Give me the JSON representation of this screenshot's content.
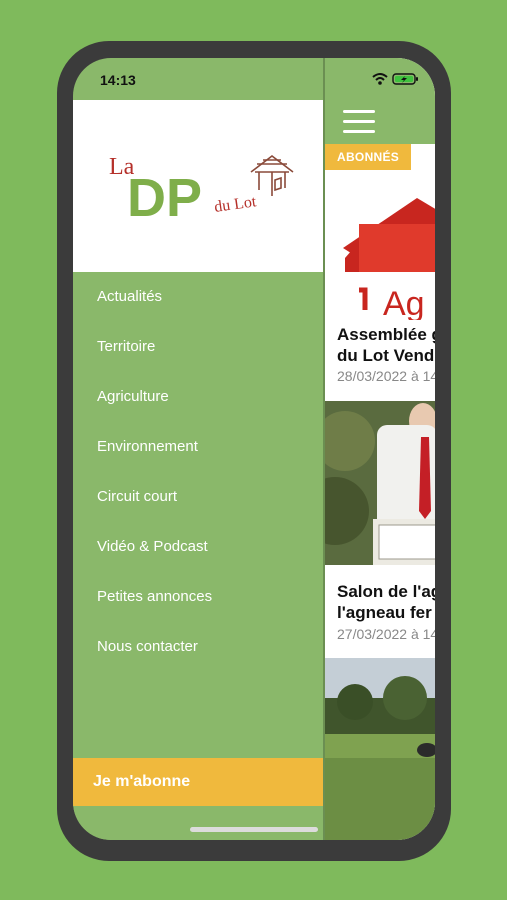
{
  "status_bar": {
    "time": "14:13"
  },
  "logo": {
    "la": "La",
    "dp": "DP",
    "du_lot": "du Lot"
  },
  "menu": {
    "items": [
      {
        "label": "Actualités"
      },
      {
        "label": "Territoire"
      },
      {
        "label": "Agriculture"
      },
      {
        "label": "Environnement"
      },
      {
        "label": "Circuit court"
      },
      {
        "label": "Vidéo & Podcast"
      },
      {
        "label": "Petites annonces"
      },
      {
        "label": "Nous contacter"
      }
    ],
    "subscribe_label": "Je m'abonne"
  },
  "main": {
    "badge": "ABONNÉS",
    "articles": [
      {
        "title_line1": "Assemblée g",
        "title_line2": "du Lot Vend",
        "date": "28/03/2022 à 14"
      },
      {
        "title_line1": "Salon de l'ag",
        "title_line2": "l'agneau fer",
        "date": "27/03/2022 à 14"
      }
    ]
  },
  "colors": {
    "background": "#7fba5c",
    "drawer": "#8ab86a",
    "accent": "#f0b93d",
    "logo_red": "#b5302a",
    "logo_green": "#7fae4a"
  },
  "icons": [
    "hamburger-icon",
    "wifi-icon",
    "battery-icon",
    "gazebo-logo-icon"
  ]
}
